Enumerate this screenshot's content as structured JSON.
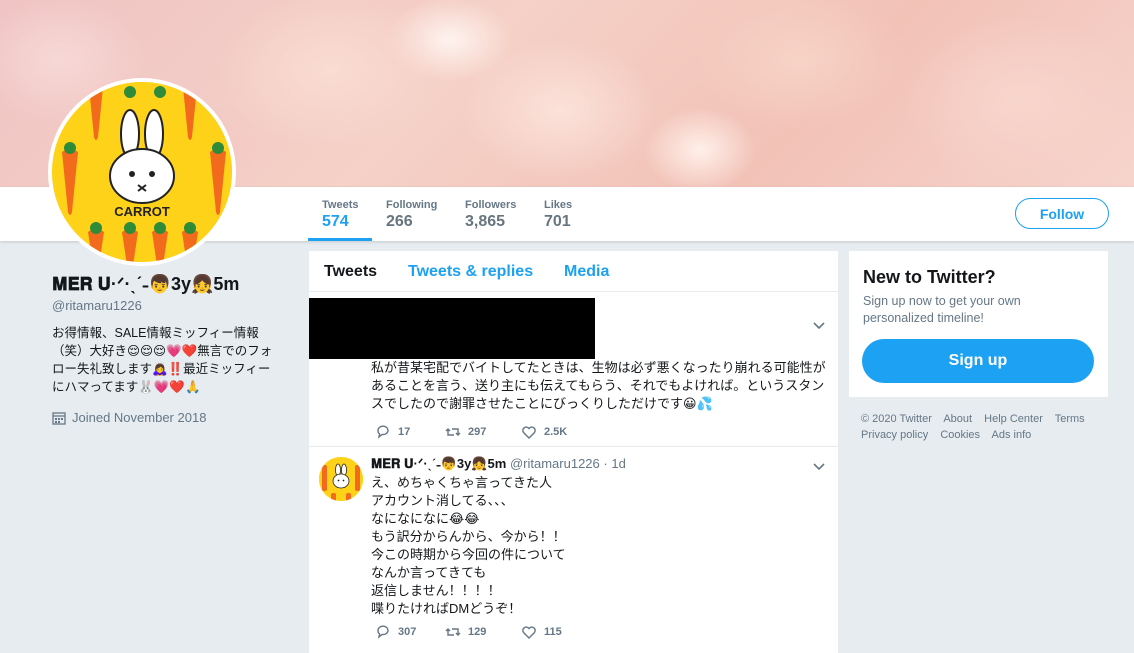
{
  "colors": {
    "accent": "#1da1f2",
    "text": "#14171a",
    "muted": "#657786",
    "background": "#e6ecf0"
  },
  "nav": {
    "stats": [
      {
        "label": "Tweets",
        "value": "574",
        "active": true
      },
      {
        "label": "Following",
        "value": "266",
        "active": false
      },
      {
        "label": "Followers",
        "value": "3,865",
        "active": false
      },
      {
        "label": "Likes",
        "value": "701",
        "active": false
      }
    ],
    "follow_label": "Follow"
  },
  "profile": {
    "avatar_text": "CARROT",
    "name": "𝐌𝐄𝐑 𝐔·ᐟ·ˎˊ˗👦3y👧5m",
    "handle": "@ritamaru1226",
    "bio": "お得情報、SALE情報ミッフィー情報（笑）大好き😌😌😌💗❤️無言でのフォロー失礼致します🙇‍♀️‼️最近ミッフィーにハマってます🐰💗❤️🙏",
    "joined": "Joined November 2018",
    "calendar_icon": "calendar-icon"
  },
  "timeline": {
    "tabs": [
      "Tweets",
      "Tweets & replies",
      "Media"
    ],
    "tweets": [
      {
        "author_name": "",
        "author_handle": "",
        "time": "",
        "text": "私が昔某宅配でバイトしてたときは、生物は必ず悪くなったり崩れる可能性があることを言う、送り主にも伝えてもらう、それでもよければ。というスタンスでしたので謝罪させたことにびっくりしただけです😀💦",
        "replies": "17",
        "retweets": "297",
        "likes": "2.5K"
      },
      {
        "author_name": "𝐌𝐄𝐑 𝐔·ᐟ·ˎˊ˗👦3y👧5m",
        "author_handle": "@ritamaru1226",
        "time": "1d",
        "lines": [
          "え、めちゃくちゃ言ってきた人",
          "アカウント消してる、、、",
          "なになになに😂😂",
          "もう訳分からんから、今から！！",
          "今この時期から今回の件について",
          "なんか言ってきても",
          "返信しません！！！！",
          "喋りたければDMどうぞ！"
        ],
        "replies": "307",
        "retweets": "129",
        "likes": "115"
      }
    ]
  },
  "sidebar": {
    "title": "New to Twitter?",
    "subtitle": "Sign up now to get your own personalized timeline!",
    "signup_label": "Sign up",
    "footer_links": [
      "© 2020 Twitter",
      "About",
      "Help Center",
      "Terms",
      "Privacy policy",
      "Cookies",
      "Ads info"
    ]
  }
}
